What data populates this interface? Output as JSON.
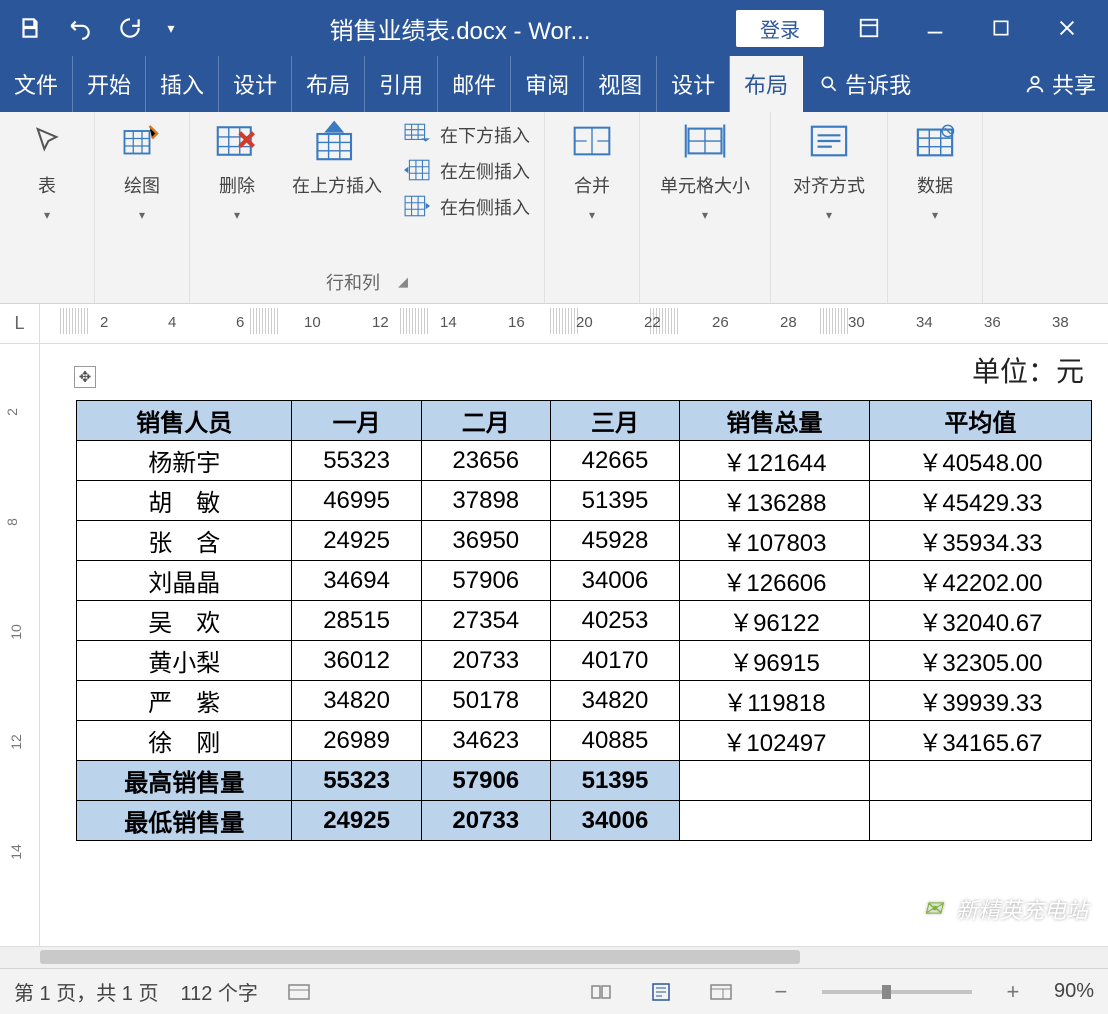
{
  "titlebar": {
    "document_title": "销售业绩表.docx - Wor...",
    "login_label": "登录"
  },
  "tabs": {
    "items": [
      "文件",
      "开始",
      "插入",
      "设计",
      "布局",
      "引用",
      "邮件",
      "审阅",
      "视图",
      "设计",
      "布局"
    ],
    "active_index": 10,
    "tell_me": "告诉我",
    "share": "共享"
  },
  "ribbon": {
    "select_label": "表",
    "draw_label": "绘图",
    "delete_label": "删除",
    "insert_above": "在上方插入",
    "insert_below": "在下方插入",
    "insert_left": "在左侧插入",
    "insert_right": "在右侧插入",
    "rows_cols_group": "行和列",
    "merge_label": "合并",
    "cell_size_label": "单元格大小",
    "alignment_label": "对齐方式",
    "data_label": "数据"
  },
  "ruler": {
    "corner": "L",
    "ticks": [
      2,
      4,
      6,
      10,
      12,
      14,
      16,
      20,
      22,
      26,
      28,
      30,
      34,
      36,
      38
    ],
    "vticks": [
      2,
      8,
      10,
      12,
      14
    ]
  },
  "doc": {
    "unit_label": "单位：元"
  },
  "table": {
    "headers": [
      "销售人员",
      "一月",
      "二月",
      "三月",
      "销售总量",
      "平均值"
    ],
    "rows": [
      {
        "name": "杨新宇",
        "m1": "55323",
        "m2": "23656",
        "m3": "42665",
        "total": "￥121644",
        "avg": "￥40548.00"
      },
      {
        "name": "胡　敏",
        "m1": "46995",
        "m2": "37898",
        "m3": "51395",
        "total": "￥136288",
        "avg": "￥45429.33"
      },
      {
        "name": "张　含",
        "m1": "24925",
        "m2": "36950",
        "m3": "45928",
        "total": "￥107803",
        "avg": "￥35934.33"
      },
      {
        "name": "刘晶晶",
        "m1": "34694",
        "m2": "57906",
        "m3": "34006",
        "total": "￥126606",
        "avg": "￥42202.00"
      },
      {
        "name": "吴　欢",
        "m1": "28515",
        "m2": "27354",
        "m3": "40253",
        "total": "￥96122",
        "avg": "￥32040.67"
      },
      {
        "name": "黄小梨",
        "m1": "36012",
        "m2": "20733",
        "m3": "40170",
        "total": "￥96915",
        "avg": "￥32305.00"
      },
      {
        "name": "严　紫",
        "m1": "34820",
        "m2": "50178",
        "m3": "34820",
        "total": "￥119818",
        "avg": "￥39939.33"
      },
      {
        "name": "徐　刚",
        "m1": "26989",
        "m2": "34623",
        "m3": "40885",
        "total": "￥102497",
        "avg": "￥34165.67"
      }
    ],
    "summary": [
      {
        "label": "最高销售量",
        "m1": "55323",
        "m2": "57906",
        "m3": "51395",
        "total": "",
        "avg": ""
      },
      {
        "label": "最低销售量",
        "m1": "24925",
        "m2": "20733",
        "m3": "34006",
        "total": "",
        "avg": ""
      }
    ]
  },
  "status": {
    "page_info": "第 1 页，共 1 页",
    "word_count": "112 个字",
    "zoom": "90%"
  },
  "watermark": {
    "text": "新精英充电站"
  }
}
